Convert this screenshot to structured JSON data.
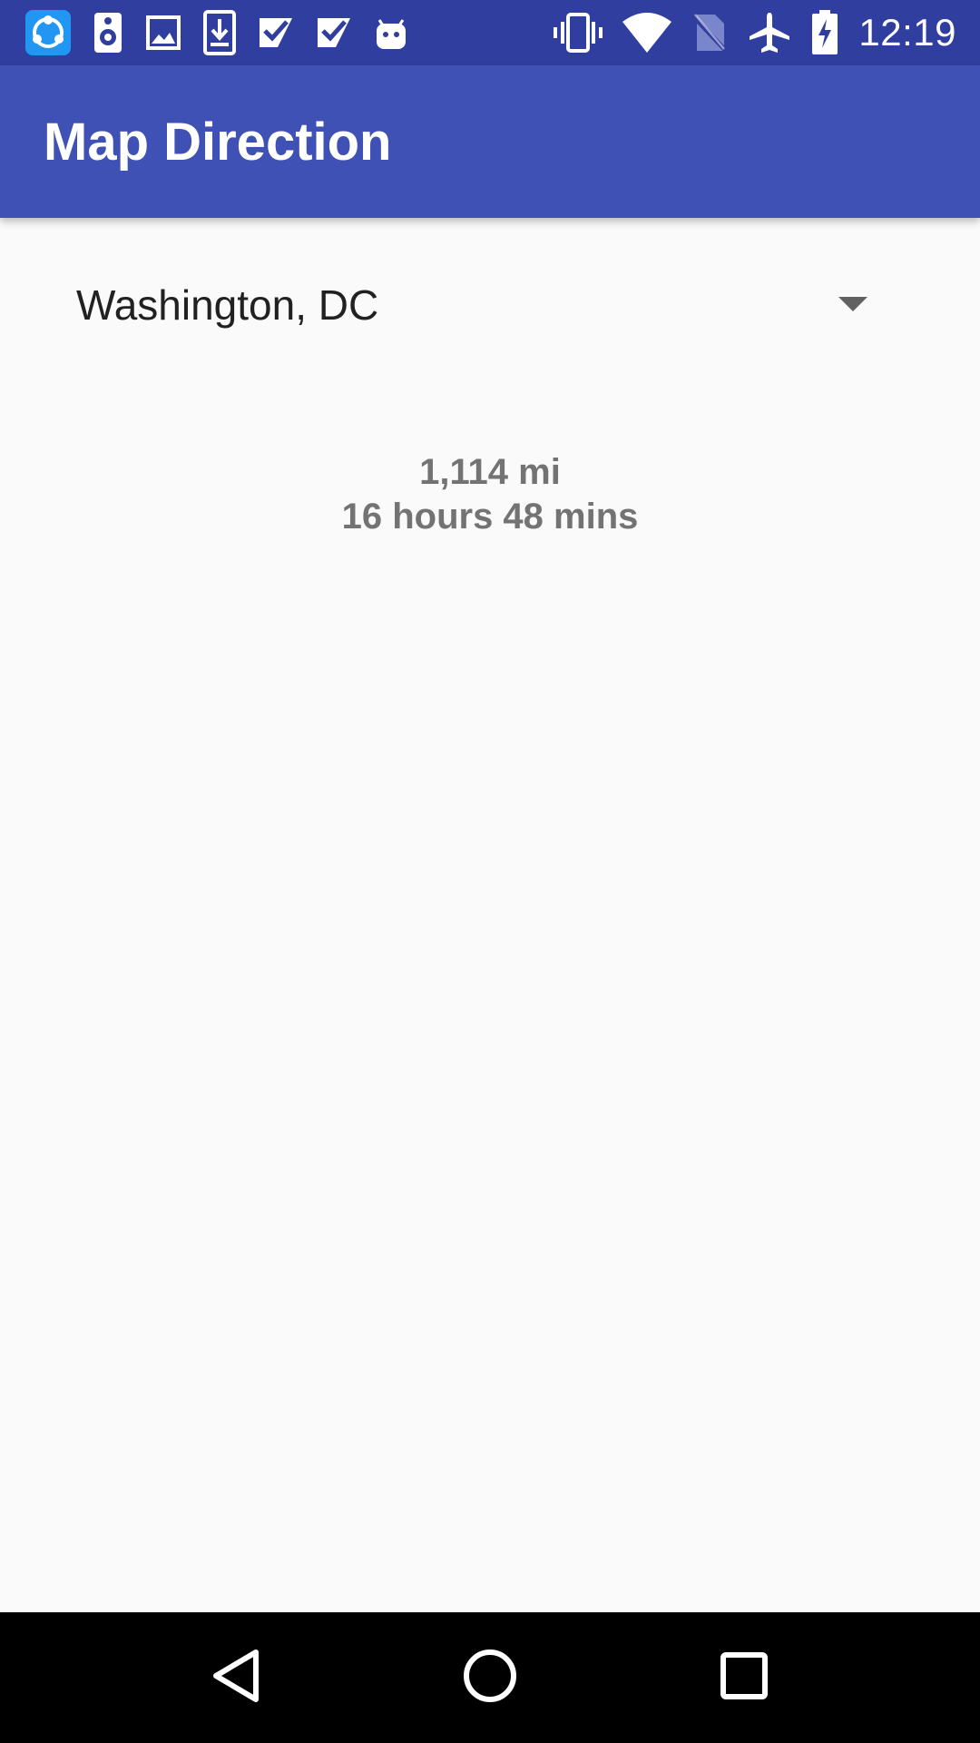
{
  "status_bar": {
    "time": "12:19",
    "notification_icons": [
      "shareit-icon",
      "speaker-icon",
      "image-icon",
      "download-icon",
      "check-icon",
      "check-icon",
      "android-icon"
    ],
    "system_icons": [
      "vibrate-icon",
      "wifi-icon",
      "no-sim-icon",
      "airplane-icon",
      "battery-charging-icon"
    ]
  },
  "app_bar": {
    "title": "Map Direction"
  },
  "destination_spinner": {
    "selected": "Washington, DC"
  },
  "result": {
    "distance": "1,114 mi",
    "duration": "16 hours 48 mins"
  },
  "nav_bar": {
    "buttons": [
      "back-icon",
      "home-icon",
      "recents-icon"
    ]
  },
  "colors": {
    "status_bar": "#303f9f",
    "app_bar": "#3f51b5",
    "background": "#fafafa",
    "result_text": "#737373"
  }
}
